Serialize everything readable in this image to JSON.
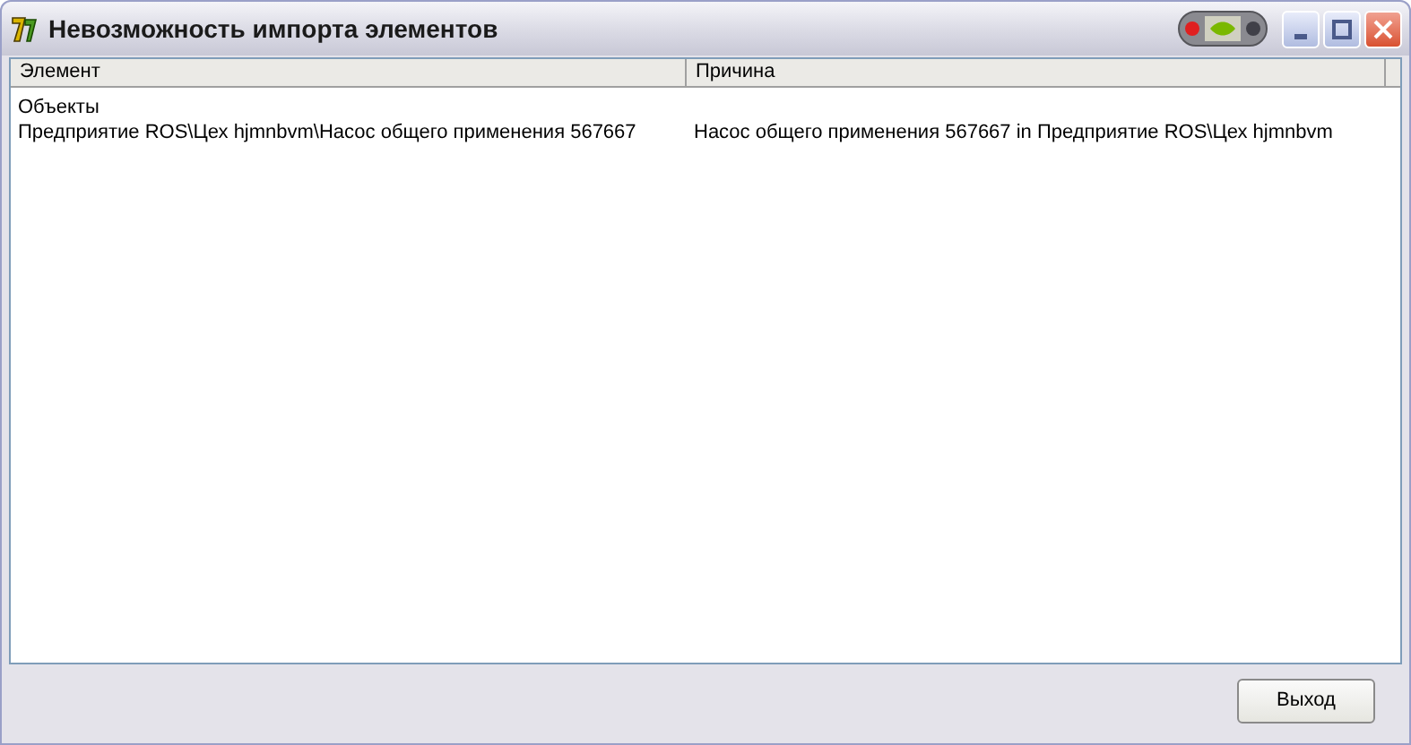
{
  "window": {
    "title": "Невозможность импорта элементов"
  },
  "table": {
    "columns": [
      "Элемент",
      "Причина"
    ],
    "rows": [
      {
        "element": "Объекты"
      },
      {
        "element": "Предприятие ROS\\Цех hjmnbvm\\Насос общего применения 567667",
        "reason": "Насос общего применения 567667 in Предприятие ROS\\Цех hjmnbvm"
      }
    ]
  },
  "buttons": [
    "Выход"
  ]
}
